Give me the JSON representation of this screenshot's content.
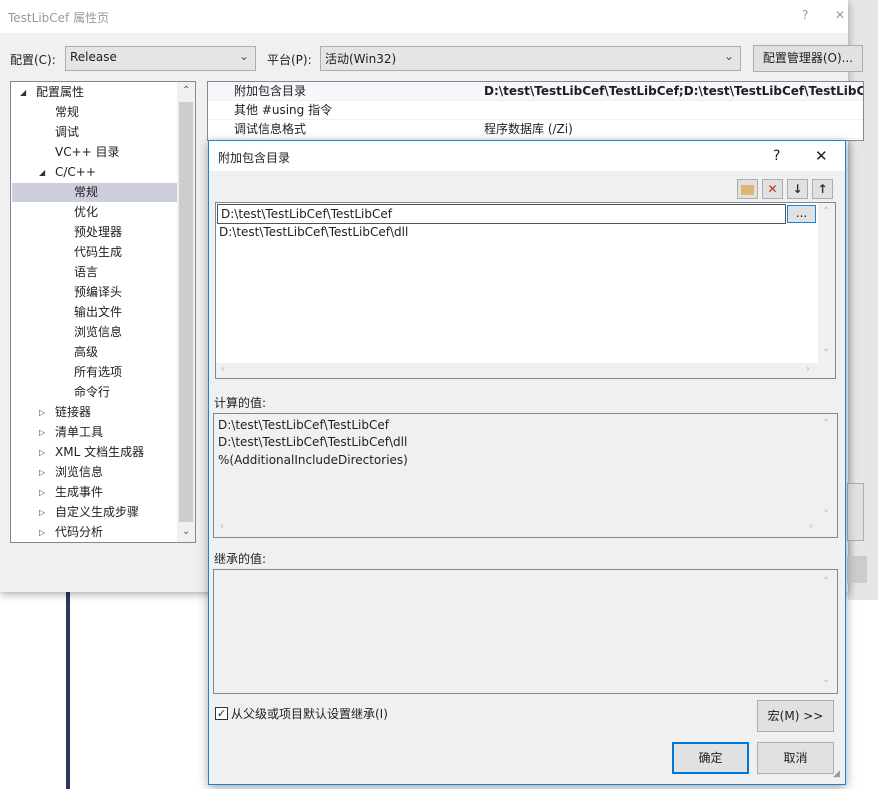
{
  "outer": {
    "title": "TestLibCef 属性页",
    "help": "?",
    "close": "✕",
    "config_label": "配置(C):",
    "config_value": "Release",
    "platform_label": "平台(P):",
    "platform_value": "活动(Win32)",
    "config_manager": "配置管理器(O)...",
    "tree": [
      {
        "label": "配置属性",
        "level": 0,
        "expander": "◢"
      },
      {
        "label": "常规",
        "level": 1
      },
      {
        "label": "调试",
        "level": 1
      },
      {
        "label": "VC++ 目录",
        "level": 1
      },
      {
        "label": "C/C++",
        "level": 1,
        "expander": "◢"
      },
      {
        "label": "常规",
        "level": 2,
        "selected": true
      },
      {
        "label": "优化",
        "level": 2
      },
      {
        "label": "预处理器",
        "level": 2
      },
      {
        "label": "代码生成",
        "level": 2
      },
      {
        "label": "语言",
        "level": 2
      },
      {
        "label": "预编译头",
        "level": 2
      },
      {
        "label": "输出文件",
        "level": 2
      },
      {
        "label": "浏览信息",
        "level": 2
      },
      {
        "label": "高级",
        "level": 2
      },
      {
        "label": "所有选项",
        "level": 2
      },
      {
        "label": "命令行",
        "level": 2
      },
      {
        "label": "链接器",
        "level": 1,
        "expander": "▷"
      },
      {
        "label": "清单工具",
        "level": 1,
        "expander": "▷"
      },
      {
        "label": "XML 文档生成器",
        "level": 1,
        "expander": "▷"
      },
      {
        "label": "浏览信息",
        "level": 1,
        "expander": "▷"
      },
      {
        "label": "生成事件",
        "level": 1,
        "expander": "▷"
      },
      {
        "label": "自定义生成步骤",
        "level": 1,
        "expander": "▷"
      },
      {
        "label": "代码分析",
        "level": 1,
        "expander": "▷"
      }
    ],
    "grid": [
      {
        "name": "附加包含目录",
        "value": "D:\\test\\TestLibCef\\TestLibCef;D:\\test\\TestLibCef\\TestLibCef\\"
      },
      {
        "name": "其他 #using 指令",
        "value": ""
      },
      {
        "name": "调试信息格式",
        "value": "程序数据库 (/Zi)"
      }
    ]
  },
  "dialog": {
    "title": "附加包含目录",
    "help": "?",
    "close": "✕",
    "entries": [
      "D:\\test\\TestLibCef\\TestLibCef",
      "D:\\test\\TestLibCef\\TestLibCef\\dll"
    ],
    "browse": "...",
    "computed_label": "计算的值:",
    "computed": [
      "D:\\test\\TestLibCef\\TestLibCef",
      "D:\\test\\TestLibCef\\TestLibCef\\dll",
      "%(AdditionalIncludeDirectories)"
    ],
    "inherited_label": "继承的值:",
    "inherit_checkbox": "从父级或项目默认设置继承(I)",
    "inherit_checked": true,
    "macros": "宏(M) >>",
    "ok": "确定",
    "cancel": "取消"
  }
}
